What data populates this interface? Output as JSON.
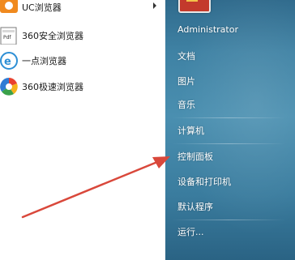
{
  "programs": [
    {
      "label": "UC浏览器",
      "icon": "uc-browser-icon",
      "has_submenu": true
    },
    {
      "label": "360安全浏览器",
      "icon": "360-safe-browser-icon",
      "has_submenu": false
    },
    {
      "label": "一点浏览器",
      "icon": "yidian-browser-icon",
      "has_submenu": false
    },
    {
      "label": "360极速浏览器",
      "icon": "360-speed-browser-icon",
      "has_submenu": false
    }
  ],
  "right_menu": {
    "user": "Administrator",
    "documents": "文档",
    "pictures": "图片",
    "music": "音乐",
    "computer": "计算机",
    "control_panel": "控制面板",
    "devices_printers": "设备和打印机",
    "default_programs": "默认程序",
    "run": "运行..."
  },
  "colors": {
    "right_pane": "#3f82a4",
    "annotation_arrow": "#d9483b"
  }
}
